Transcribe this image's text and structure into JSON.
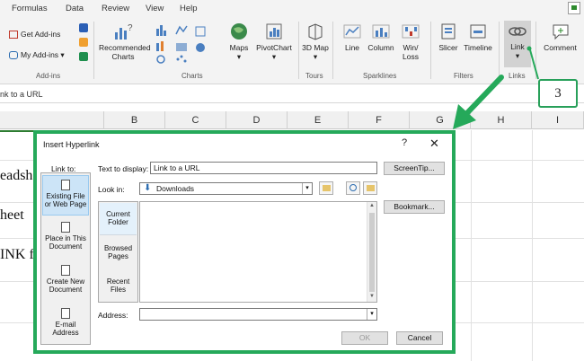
{
  "ribbon": {
    "tabs": [
      "Formulas",
      "Data",
      "Review",
      "View",
      "Help"
    ],
    "addins": {
      "get_addins": "Get Add-ins",
      "my_addins": "My Add-ins",
      "group": "Add-ins"
    },
    "charts": {
      "recommended": "Recommended Charts",
      "maps": "Maps",
      "pivotchart": "PivotChart",
      "group": "Charts"
    },
    "tours": {
      "map3d": "3D Map",
      "group": "Tours"
    },
    "sparklines": {
      "line": "Line",
      "column": "Column",
      "winloss": "Win/ Loss",
      "group": "Sparklines"
    },
    "filters": {
      "slicer": "Slicer",
      "timeline": "Timeline",
      "group": "Filters"
    },
    "links": {
      "link": "Link",
      "group": "Links"
    },
    "comments": {
      "comment": "Comment"
    },
    "accent_color": "#25a95a"
  },
  "formula_bar": {
    "text": "nk to a URL"
  },
  "columns": [
    "B",
    "C",
    "D",
    "E",
    "F",
    "G",
    "H",
    "I"
  ],
  "cells": [
    "eadsh",
    "heet",
    "INK f"
  ],
  "callout": {
    "number": "3"
  },
  "dialog": {
    "title": "Insert Hyperlink",
    "help": "?",
    "close": "✕",
    "link_to_label": "Link to:",
    "link_targets": [
      {
        "label": "Existing File or Web Page",
        "selected": true
      },
      {
        "label": "Place in This Document",
        "selected": false
      },
      {
        "label": "Create New Document",
        "selected": false
      },
      {
        "label": "E-mail Address",
        "selected": false
      }
    ],
    "text_to_display_label": "Text to display:",
    "text_to_display_value": "Link to a URL",
    "screentip_button": "ScreenTip...",
    "look_in_label": "Look in:",
    "look_in_value": "Downloads",
    "look_in_buttons": [
      {
        "label": "Current Folder",
        "selected": true
      },
      {
        "label": "Browsed Pages",
        "selected": false
      },
      {
        "label": "Recent Files",
        "selected": false
      }
    ],
    "bookmark_button": "Bookmark...",
    "address_label": "Address:",
    "address_value": "",
    "ok_button": "OK",
    "cancel_button": "Cancel"
  }
}
